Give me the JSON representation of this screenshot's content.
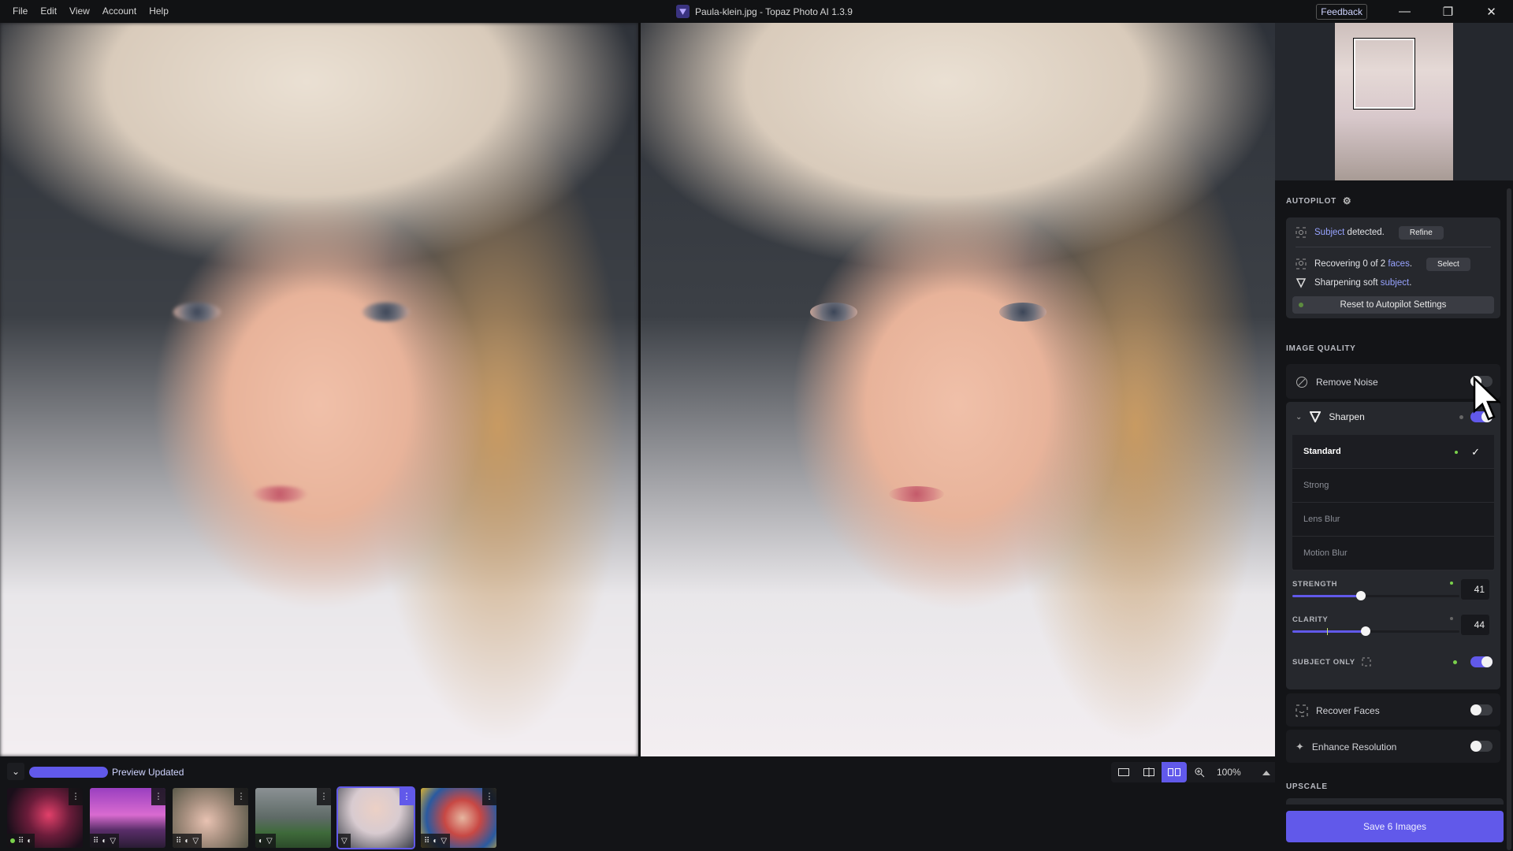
{
  "titlebar": {
    "menu": [
      "File",
      "Edit",
      "View",
      "Account",
      "Help"
    ],
    "title": "Paula-klein.jpg - Topaz Photo AI 1.3.9",
    "feedback_label": "Feedback"
  },
  "preview": {
    "status": "Preview Updated",
    "progress_percent": 100,
    "zoom_level": "100%",
    "view_modes": [
      "single-view",
      "split-view",
      "side-by-side-view"
    ],
    "active_view_mode": "side-by-side-view"
  },
  "filmstrip": {
    "items": [
      {
        "name": "city-night",
        "badges": [
          "face",
          "noise"
        ],
        "selected": false,
        "status_dot": true
      },
      {
        "name": "bridge-purple",
        "badges": [
          "face",
          "noise",
          "sharpen"
        ],
        "selected": false,
        "status_dot": false
      },
      {
        "name": "child-window",
        "badges": [
          "face",
          "noise",
          "sharpen"
        ],
        "selected": false,
        "status_dot": false
      },
      {
        "name": "windmill",
        "badges": [
          "noise",
          "sharpen"
        ],
        "selected": false,
        "status_dot": false
      },
      {
        "name": "paula-klein",
        "badges": [
          "sharpen"
        ],
        "selected": true,
        "status_dot": false
      },
      {
        "name": "ball-pit",
        "badges": [
          "face",
          "noise",
          "sharpen"
        ],
        "selected": false,
        "status_dot": false
      }
    ]
  },
  "panel": {
    "autopilot": {
      "heading": "AUTOPILOT",
      "subject_hl": "Subject",
      "subject_rest": " detected.",
      "refine_label": "Refine",
      "faces_pre": "Recovering 0 of 2 ",
      "faces_hl": "faces",
      "faces_post": ".",
      "select_label": "Select",
      "sharpen_pre": "Sharpening soft ",
      "sharpen_hl": "subject",
      "sharpen_post": ".",
      "reset_label": "Reset to Autopilot Settings"
    },
    "image_quality": {
      "heading": "IMAGE QUALITY",
      "remove_noise": {
        "label": "Remove Noise",
        "enabled": false
      },
      "sharpen": {
        "label": "Sharpen",
        "enabled": true,
        "models": [
          "Standard",
          "Strong",
          "Lens Blur",
          "Motion Blur"
        ],
        "selected_model": "Standard",
        "strength_label": "STRENGTH",
        "strength": 41,
        "clarity_label": "CLARITY",
        "clarity": 44,
        "subject_only_label": "SUBJECT ONLY",
        "subject_only": true
      },
      "recover_faces": {
        "label": "Recover Faces",
        "enabled": false
      },
      "enhance_resolution": {
        "label": "Enhance Resolution",
        "enabled": false
      }
    },
    "upscale": {
      "heading": "UPSCALE"
    },
    "save_label": "Save 6 Images"
  },
  "colors": {
    "accent": "#6159ea",
    "status_green": "#7ad14b",
    "link": "#97a3ff"
  }
}
